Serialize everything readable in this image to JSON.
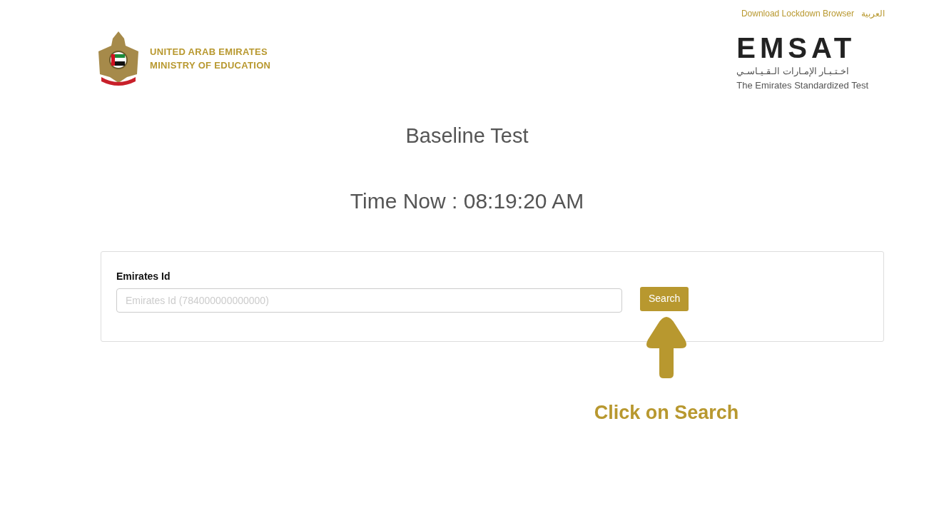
{
  "top_links": [
    {
      "label": "Download Lockdown Browser"
    },
    {
      "label": "العربية"
    }
  ],
  "ministry_logo": {
    "line_1": "UNITED ARAB EMIRATES",
    "line_2": "MINISTRY OF EDUCATION"
  },
  "emsat_logo": {
    "wordmark": "EMSAT",
    "arabic": "اخـتـبـار الإمـارات الـقـيـاسـي",
    "tagline": "The Emirates Standardized Test"
  },
  "title": "Baseline Test",
  "time_now": "Time Now : 08:19:20 AM",
  "form": {
    "label": "Emirates Id",
    "placeholder": "Emirates Id (784000000000000)",
    "button": "Search"
  },
  "hint": "Click on Search"
}
